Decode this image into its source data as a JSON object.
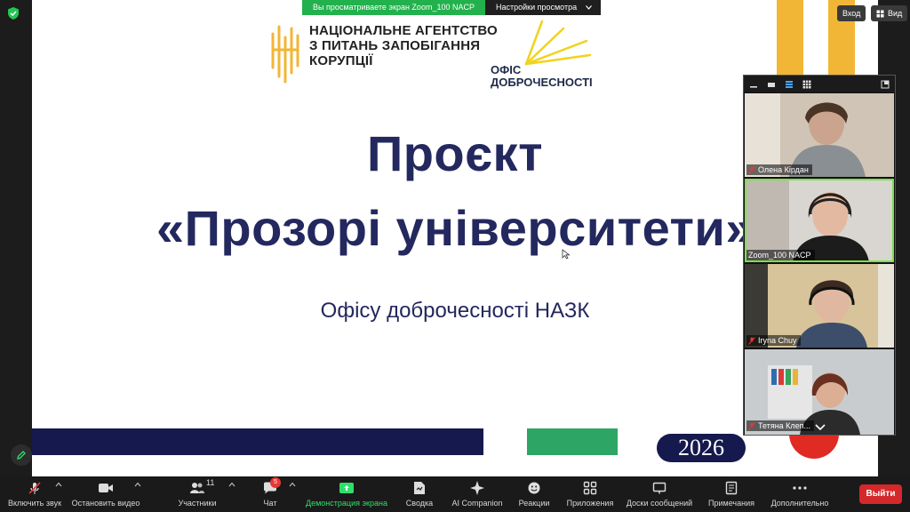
{
  "share_banner": {
    "viewing_text": "Вы просматриваете экран Zoom_100 NACP",
    "settings_label": "Настройки просмотра"
  },
  "top_right": {
    "login_label": "Вход",
    "view_label": "Вид"
  },
  "slide": {
    "nazk_logo_lines": [
      "НАЦІОНАЛЬНЕ АГЕНТСТВО",
      "З ПИТАНЬ ЗАПОБІГАННЯ",
      "КОРУПЦІЇ"
    ],
    "office_logo_lines": [
      "ОФІС",
      "ДОБРОЧЕСНОСТІ"
    ],
    "title": "Проєкт",
    "subtitle": "«Прозорі університети»",
    "caption": "Офісу доброчесності НАЗК",
    "year": "2026",
    "colors": {
      "navy": "#15194d",
      "title": "#23285e",
      "green": "#2da565",
      "gold": "#f2b636",
      "red": "#e02a24"
    }
  },
  "participants": [
    {
      "name": "Олена Кірдан",
      "muted": true
    },
    {
      "name": "Zoom_100 NACP",
      "muted": false,
      "active_speaker": true
    },
    {
      "name": "Iryna Chuy",
      "muted": true
    },
    {
      "name": "Тетяна Клеп...",
      "muted": true
    }
  ],
  "toolbar": {
    "items": [
      {
        "label": "Включить звук",
        "icon": "mic-off-icon"
      },
      {
        "label": "Остановить видео",
        "icon": "video-camera-icon"
      },
      {
        "label": "Участники",
        "icon": "participants-icon",
        "count": "11"
      },
      {
        "label": "Чат",
        "icon": "chat-icon",
        "badge": "5"
      },
      {
        "label": "Демонстрация экрана",
        "icon": "share-screen-icon"
      },
      {
        "label": "Сводка",
        "icon": "summary-icon"
      },
      {
        "label": "AI Companion",
        "icon": "ai-companion-icon"
      },
      {
        "label": "Реакции",
        "icon": "reactions-icon"
      },
      {
        "label": "Приложения",
        "icon": "apps-icon"
      },
      {
        "label": "Доски сообщений",
        "icon": "whiteboards-icon"
      },
      {
        "label": "Примечания",
        "icon": "notes-icon"
      },
      {
        "label": "Дополнительно",
        "icon": "more-icon"
      }
    ],
    "exit_label": "Выйти"
  }
}
